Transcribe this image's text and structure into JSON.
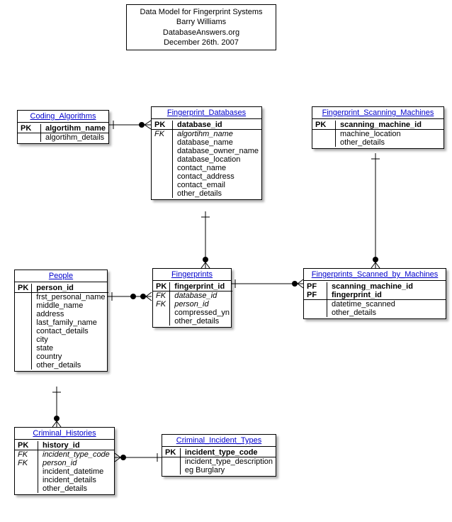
{
  "header": {
    "line1": "Data Model for Fingerprint Systems",
    "line2": "Barry Williams",
    "line3": "DatabaseAnswers.org",
    "line4": "December 26th. 2007"
  },
  "entities": {
    "coding_algorithms": {
      "title": "Coding_Algorithms",
      "rows": [
        {
          "key": "PK",
          "name": "algortihm_name",
          "pk": true
        },
        {
          "key": "",
          "name": "algortihm_details"
        }
      ]
    },
    "fingerprint_databases": {
      "title": "Fingerprint_Databases",
      "rows": [
        {
          "key": "PK",
          "name": "database_id",
          "pk": true
        },
        {
          "key": "FK",
          "name": "algortihm_name",
          "fk": true,
          "keyItalic": true
        },
        {
          "key": "",
          "name": "database_name"
        },
        {
          "key": "",
          "name": "database_owner_name"
        },
        {
          "key": "",
          "name": "database_location"
        },
        {
          "key": "",
          "name": "contact_name"
        },
        {
          "key": "",
          "name": "contact_address"
        },
        {
          "key": "",
          "name": "contact_email"
        },
        {
          "key": "",
          "name": "other_details"
        }
      ]
    },
    "fingerprint_scanning_machines": {
      "title": "Fingerprint_Scanning_Machines",
      "rows": [
        {
          "key": "PK",
          "name": "scanning_machine_id",
          "pk": true
        },
        {
          "key": "",
          "name": "machine_location"
        },
        {
          "key": "",
          "name": "other_details"
        }
      ]
    },
    "people": {
      "title": "People",
      "rows": [
        {
          "key": "PK",
          "name": "person_id",
          "pk": true
        },
        {
          "key": "",
          "name": "frst_personal_name"
        },
        {
          "key": "",
          "name": "middle_name"
        },
        {
          "key": "",
          "name": "address"
        },
        {
          "key": "",
          "name": "last_family_name"
        },
        {
          "key": "",
          "name": "contact_details"
        },
        {
          "key": "",
          "name": "city"
        },
        {
          "key": "",
          "name": "state"
        },
        {
          "key": "",
          "name": "country"
        },
        {
          "key": "",
          "name": "other_details"
        }
      ]
    },
    "fingerprints": {
      "title": "Fingerprints",
      "rows": [
        {
          "key": "PK",
          "name": "fingerprint_id",
          "pk": true
        },
        {
          "key": "FK",
          "name": "database_id",
          "fk": true,
          "keyItalic": true
        },
        {
          "key": "FK",
          "name": "person_id",
          "fk": true,
          "keyItalic": true
        },
        {
          "key": "",
          "name": "compressed_yn"
        },
        {
          "key": "",
          "name": "other_details"
        }
      ]
    },
    "fingerprints_scanned_by_machines": {
      "title": "Fingerprints_Scanned_by_Machines",
      "rows": [
        {
          "key": "PF",
          "name": "scanning_machine_id",
          "pk": true
        },
        {
          "key": "PF",
          "name": "fingerprint_id",
          "pk": true
        },
        {
          "key": "",
          "name": "datetime_scanned"
        },
        {
          "key": "",
          "name": "other_details"
        }
      ]
    },
    "criminal_histories": {
      "title": "Criminal_Histories",
      "rows": [
        {
          "key": "PK",
          "name": "history_id",
          "pk": true
        },
        {
          "key": "FK",
          "name": "incident_type_code",
          "fk": true,
          "keyItalic": true
        },
        {
          "key": "FK",
          "name": "person_id",
          "fk": true,
          "keyItalic": true
        },
        {
          "key": "",
          "name": "incident_datetime"
        },
        {
          "key": "",
          "name": "incident_details"
        },
        {
          "key": "",
          "name": "other_details"
        }
      ]
    },
    "criminal_incident_types": {
      "title": "Criminal_Incident_Types",
      "rows": [
        {
          "key": "PK",
          "name": "incident_type_code",
          "pk": true
        },
        {
          "key": "",
          "name": "incident_type_description"
        },
        {
          "key": "",
          "name": "eg Burglary"
        }
      ]
    }
  }
}
